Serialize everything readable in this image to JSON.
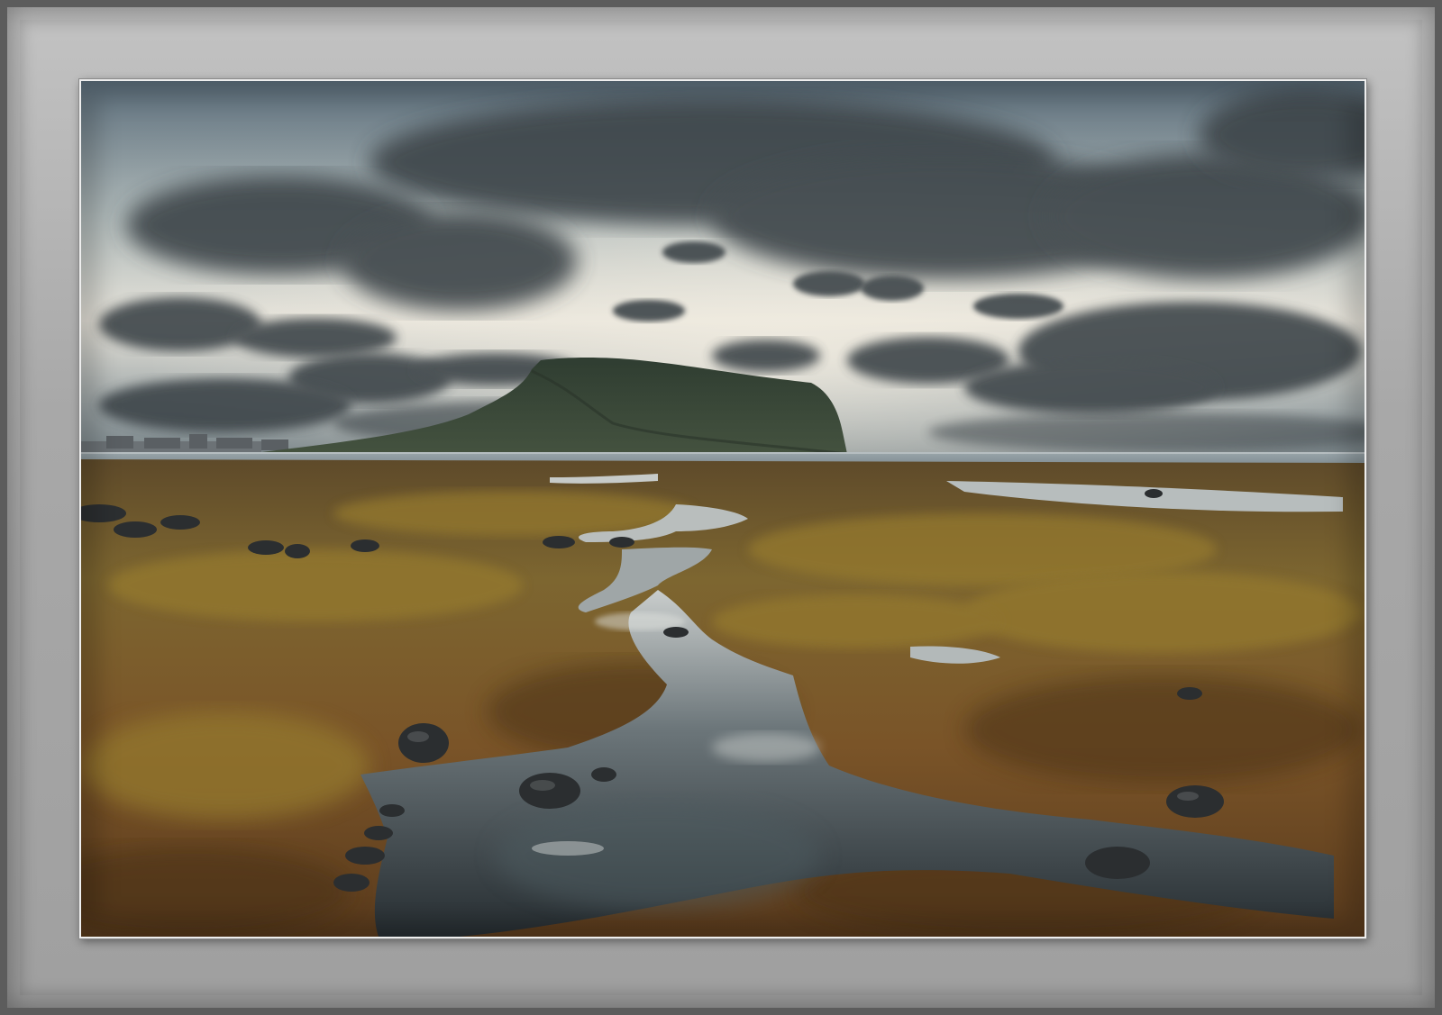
{
  "image": {
    "kind": "framed landscape photograph",
    "colors": {
      "frame_outer": "#5c5c5c",
      "mat": "#a8a8a8",
      "photo_border": "#eeeeee",
      "sky_top": "#5d6f7c",
      "sky_horizon": "#e6e3da",
      "cloud_dark": "#3d4449",
      "mountain": "#3a4a3a",
      "sea": "#8d9aa0",
      "moss": "#8a6a2a",
      "water": "#2f3a40"
    }
  }
}
